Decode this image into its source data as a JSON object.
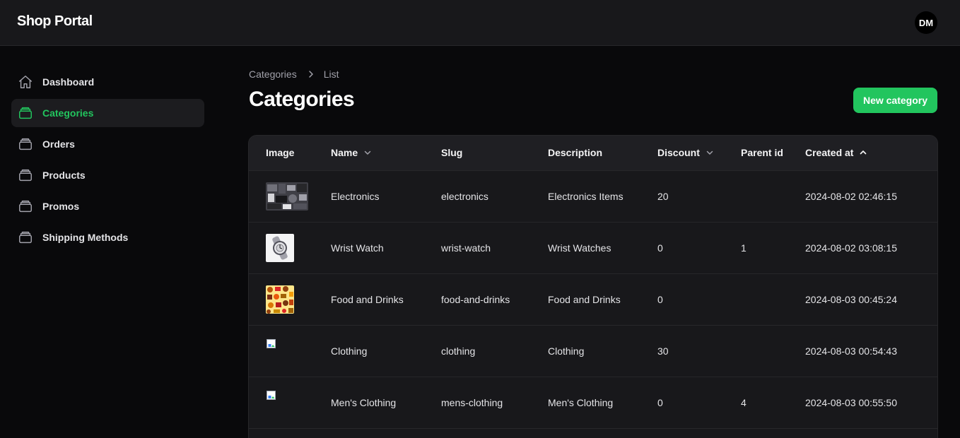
{
  "app": {
    "title": "Shop Portal",
    "user_initials": "DM"
  },
  "sidebar": {
    "items": [
      {
        "label": "Dashboard",
        "icon": "home-icon",
        "active": false
      },
      {
        "label": "Categories",
        "icon": "stack-icon",
        "active": true
      },
      {
        "label": "Orders",
        "icon": "stack-icon",
        "active": false
      },
      {
        "label": "Products",
        "icon": "stack-icon",
        "active": false
      },
      {
        "label": "Promos",
        "icon": "stack-icon",
        "active": false
      },
      {
        "label": "Shipping Methods",
        "icon": "stack-icon",
        "active": false
      }
    ]
  },
  "breadcrumb": {
    "parent": "Categories",
    "current": "List"
  },
  "page": {
    "title": "Categories",
    "new_button": "New category"
  },
  "table": {
    "columns": {
      "image": "Image",
      "name": "Name",
      "slug": "Slug",
      "description": "Description",
      "discount": "Discount",
      "parent_id": "Parent id",
      "created_at": "Created at"
    },
    "sort": {
      "created_at": "ascending"
    },
    "rows": [
      {
        "image": "electronics-thumbnail",
        "name": "Electronics",
        "slug": "electronics",
        "description": "Electronics Items",
        "discount": "20",
        "parent_id": "",
        "created_at": "2024-08-02 02:46:15"
      },
      {
        "image": "wrist-watch-thumbnail",
        "name": "Wrist Watch",
        "slug": "wrist-watch",
        "description": "Wrist Watches",
        "discount": "0",
        "parent_id": "1",
        "created_at": "2024-08-02 03:08:15"
      },
      {
        "image": "food-thumbnail",
        "name": "Food and Drinks",
        "slug": "food-and-drinks",
        "description": "Food and Drinks",
        "discount": "0",
        "parent_id": "",
        "created_at": "2024-08-03 00:45:24"
      },
      {
        "image": "broken-image",
        "name": "Clothing",
        "slug": "clothing",
        "description": "Clothing",
        "discount": "30",
        "parent_id": "",
        "created_at": "2024-08-03 00:54:43"
      },
      {
        "image": "broken-image",
        "name": "Men's Clothing",
        "slug": "mens-clothing",
        "description": "Men's Clothing",
        "discount": "0",
        "parent_id": "4",
        "created_at": "2024-08-03 00:55:50"
      }
    ]
  },
  "colors": {
    "accent": "#22c55e",
    "background": "#09090b",
    "surface": "#18181b",
    "border": "#27272a"
  }
}
